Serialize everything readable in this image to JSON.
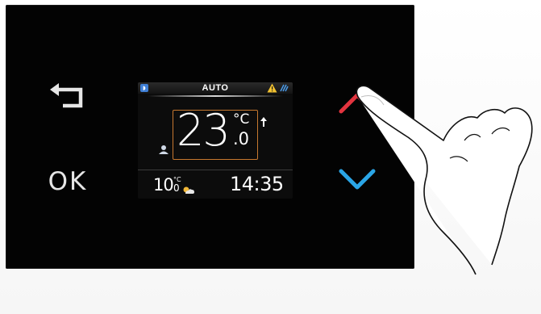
{
  "buttons": {
    "back": {
      "icon": "back-arrow-icon"
    },
    "ok": {
      "label": "OK"
    },
    "up": {
      "icon": "chevron-up-icon",
      "color": "#e3343f"
    },
    "down": {
      "icon": "chevron-down-icon",
      "color": "#2aa5e6"
    }
  },
  "display": {
    "mode": "AUTO",
    "top_icons": [
      "wifi-icon",
      "warning-icon",
      "bluetooth-icon"
    ],
    "setpoint": {
      "integer": "23",
      "unit": "°C",
      "decimal": ".0",
      "trend_icon": "arrow-up-icon"
    },
    "presence_icon": "person-icon",
    "outdoor": {
      "integer": "10",
      "unit": "°C",
      "decimal": "0",
      "icon": "sun-cloud-icon"
    },
    "clock": "14:35",
    "accent_color": "#c7782f"
  },
  "overlay": {
    "icon": "pointing-hand-icon"
  }
}
